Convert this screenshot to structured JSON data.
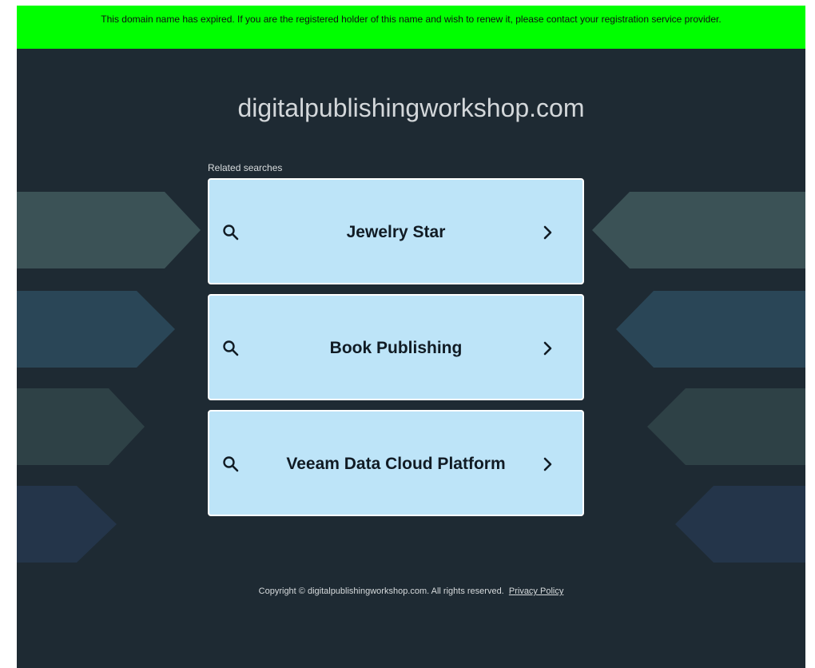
{
  "banner": {
    "text": "This domain name has expired. If you are the registered holder of this name and wish to renew it, please contact your registration service provider."
  },
  "site": {
    "domain": "digitalpublishingworkshop.com"
  },
  "related": {
    "label": "Related searches",
    "items": [
      {
        "label": "Jewelry Star",
        "left_icon": "search-icon",
        "right_icon": "chevron-right-icon"
      },
      {
        "label": "Book Publishing",
        "left_icon": "search-icon",
        "right_icon": "chevron-right-icon"
      },
      {
        "label": "Veeam Data Cloud Platform",
        "left_icon": "search-icon",
        "right_icon": "chevron-right-icon"
      }
    ]
  },
  "footer": {
    "copyright": "Copyright © digitalpublishingworkshop.com.  All rights reserved.",
    "privacy_link": "Privacy Policy"
  },
  "colors": {
    "banner_bg": "#00ff00",
    "page_bg": "#1e2a33",
    "card_bg": "#bde4f8",
    "card_text": "#111b24"
  }
}
